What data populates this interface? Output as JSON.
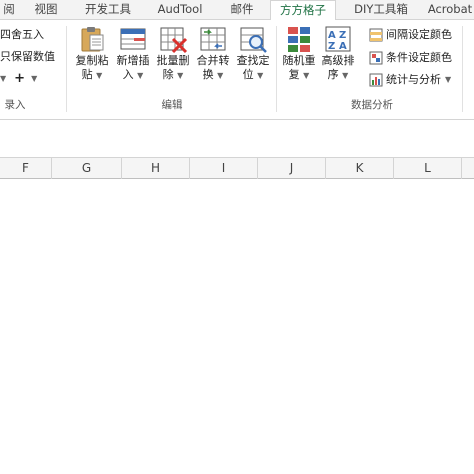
{
  "tabs": [
    {
      "label": "阅",
      "active": false
    },
    {
      "label": "视图",
      "active": false
    },
    {
      "label": "开发工具",
      "active": false
    },
    {
      "label": "AudTool",
      "active": false
    },
    {
      "label": "邮件",
      "active": false
    },
    {
      "label": "方方格子",
      "active": true
    },
    {
      "label": "DIY工具箱",
      "active": false
    },
    {
      "label": "Acrobat",
      "active": false
    }
  ],
  "ribbon": {
    "left_group": {
      "items": [
        "四舍五入",
        "只保留数值"
      ],
      "plus_label": "+",
      "label": "录入"
    },
    "edit_group": {
      "buttons": [
        {
          "line1": "复制粘",
          "line2": "贴",
          "icon": "clipboard-icon"
        },
        {
          "line1": "新增插",
          "line2": "入",
          "icon": "insert-icon"
        },
        {
          "line1": "批量删",
          "line2": "除",
          "icon": "delete-icon"
        },
        {
          "line1": "合并转",
          "line2": "换",
          "icon": "merge-icon"
        },
        {
          "line1": "查找定",
          "line2": "位",
          "icon": "find-icon"
        }
      ],
      "label": "编辑"
    },
    "data_group": {
      "buttons": [
        {
          "line1": "随机重",
          "line2": "复",
          "icon": "random-icon"
        },
        {
          "line1": "高级排",
          "line2": "序",
          "icon": "sort-icon"
        }
      ],
      "small_items": [
        {
          "label": "间隔设定颜色",
          "icon": "interval-color-icon"
        },
        {
          "label": "条件设定颜色",
          "icon": "condition-color-icon"
        },
        {
          "label": "统计与分析",
          "icon": "stats-icon"
        }
      ],
      "label": "数据分析"
    }
  },
  "columns": [
    "F",
    "G",
    "H",
    "I",
    "J",
    "K",
    "L"
  ],
  "colors": {
    "accent": "#217346"
  }
}
